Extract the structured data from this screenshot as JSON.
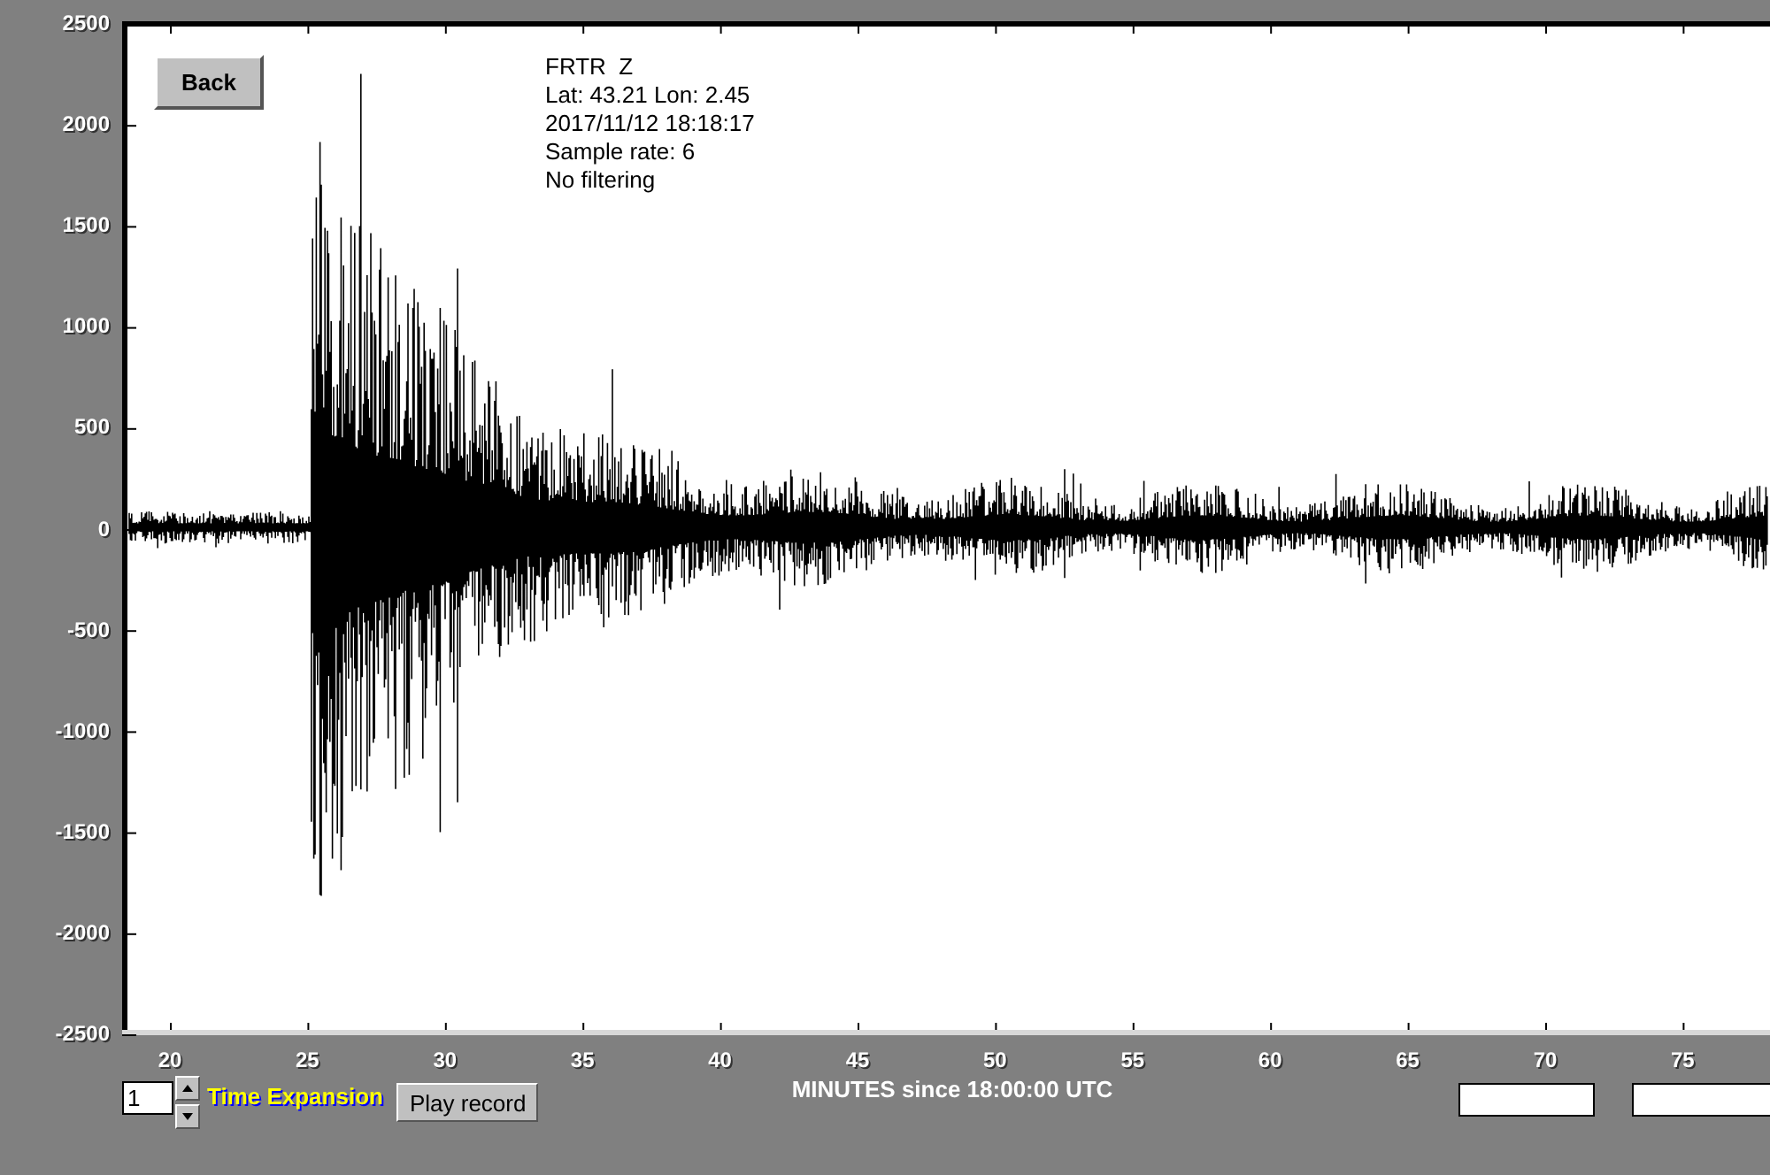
{
  "back_button": "Back",
  "station_info": [
    "FRTR  Z",
    "Lat: 43.21 Lon: 2.45",
    "2017/11/12 18:18:17",
    "Sample rate: 6",
    "No filtering"
  ],
  "y_ticks": [
    "2500",
    "2000",
    "1500",
    "1000",
    "500",
    "0",
    "-500",
    "-1000",
    "-1500",
    "-2000",
    "-2500"
  ],
  "x_ticks": [
    "20",
    "25",
    "30",
    "35",
    "40",
    "45",
    "50",
    "55",
    "60",
    "65",
    "70",
    "75"
  ],
  "x_axis_label": "MINUTES since 18:00:00 UTC",
  "time_expansion": {
    "value": "1",
    "label": "Time Expansion"
  },
  "play_button": "Play record"
}
